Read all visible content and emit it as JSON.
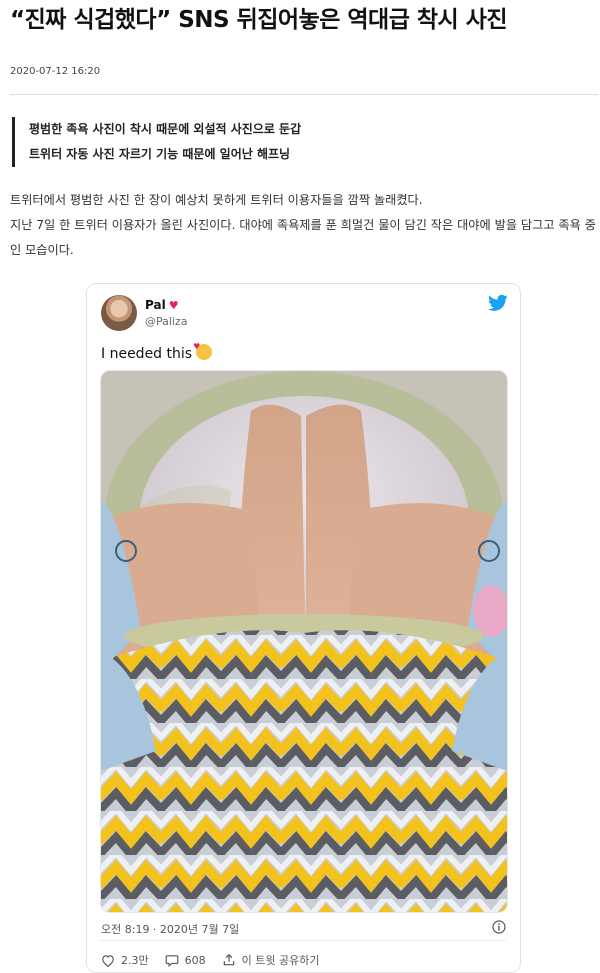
{
  "article": {
    "headline": "“진짜 식겁했다” SNS 뒤집어놓은 역대급 착시 사진",
    "date": "2020-07-12 16:20",
    "summary": [
      "평범한 족욕 사진이 착시 때문에 외설적 사진으로 둔갑",
      "트위터 자동 사진 자르기 기능 때문에 일어난 해프닝"
    ],
    "body": [
      "트위터에서 평범한 사진 한 장이 예상치 못하게 트위터 이용자들을 깜짝 놀래켰다.",
      "지난 7일 한 트위터 이용자가 올린 사진이다. 대야에 족욕제를 푼 희멀건 물이 담긴 작은 대야에 발을 담그고 족욕 중인 모습이다."
    ]
  },
  "tweet": {
    "author_name": "Pal",
    "author_handle": "@Paliza",
    "text": "I needed this",
    "timestamp": "오전 8:19 · 2020년 7월 7일",
    "likes": "2.3만",
    "replies": "608",
    "share_label": "이 트윗 공유하기",
    "icons": {
      "brand": "twitter-bird-icon",
      "heart": "heart-icon",
      "reply": "speech-bubble-icon",
      "share": "share-arrow-icon",
      "info": "info-circle-icon"
    },
    "colors": {
      "twitter_blue": "#1da1f2",
      "heart_red": "#e0245e"
    }
  }
}
